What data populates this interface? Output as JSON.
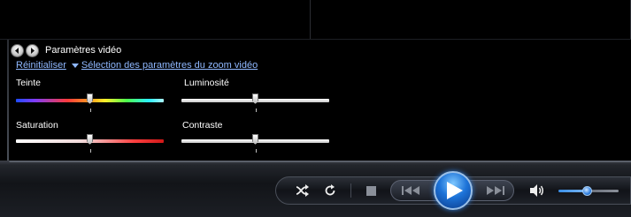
{
  "panel": {
    "title": "Paramètres vidéo",
    "reset_link": "Réinitialiser",
    "zoom_link": "Sélection des paramètres du zoom vidéo"
  },
  "sliders": {
    "hue": {
      "label": "Teinte",
      "value": 0.5
    },
    "brightness": {
      "label": "Luminosité",
      "value": 0.5
    },
    "saturation": {
      "label": "Saturation",
      "value": 0.5
    },
    "contrast": {
      "label": "Contraste",
      "value": 0.5
    }
  },
  "player": {
    "volume": 0.47,
    "accent_color": "#1d73d8"
  },
  "icons": [
    "back-icon",
    "forward-icon",
    "chevron-down-icon",
    "shuffle-icon",
    "repeat-icon",
    "stop-icon",
    "previous-icon",
    "play-icon",
    "next-icon",
    "volume-icon"
  ]
}
